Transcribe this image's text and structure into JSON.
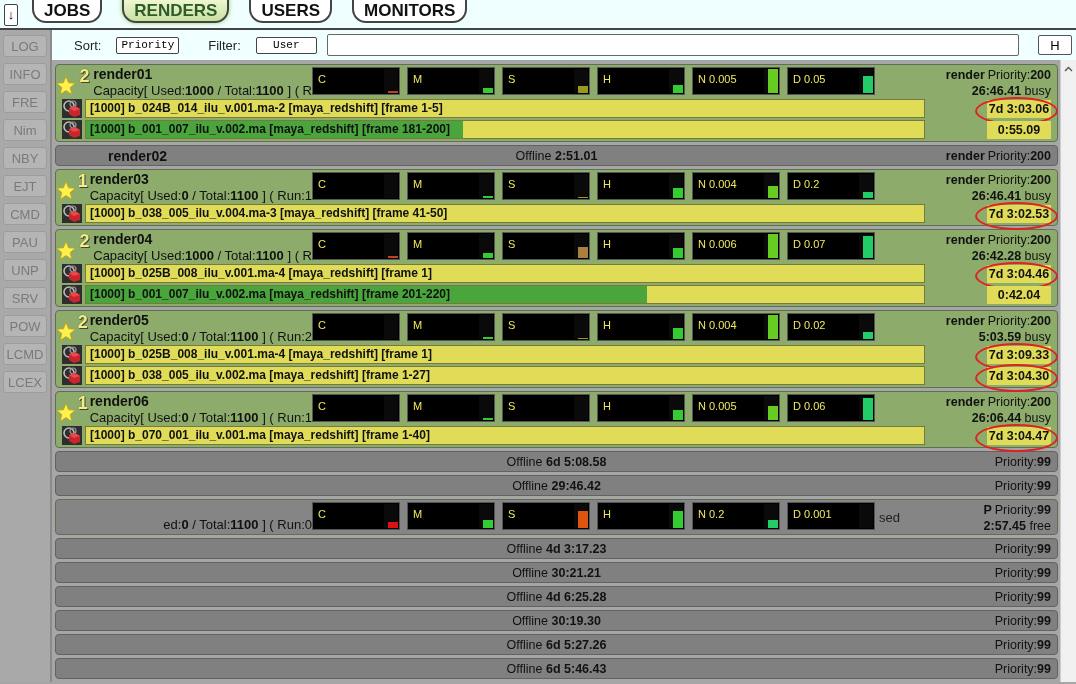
{
  "collapse_button": {
    "label": "↓"
  },
  "tabs": [
    {
      "label": "JOBS",
      "selected": false
    },
    {
      "label": "RENDERS",
      "selected": true
    },
    {
      "label": "USERS",
      "selected": false
    },
    {
      "label": "MONITORS",
      "selected": false
    }
  ],
  "side_buttons": [
    "LOG",
    "INFO",
    "FRE",
    "Nim",
    "NBY",
    "EJT",
    "CMD",
    "PAU",
    "UNP",
    "SRV",
    "POW",
    "LCMD",
    "LCEX"
  ],
  "toolbar": {
    "sort_label": "Sort:",
    "sort_value": "Priority",
    "filter_label": "Filter:",
    "filter_value": "User",
    "h_button": "H"
  },
  "renders": [
    {
      "kind": "online",
      "count": "2",
      "name": "render01",
      "capacity": "Capacity[ Used:**1000** / Total:**1100** ] ( R",
      "meters": [
        {
          "label": "C",
          "level": 0.08,
          "color": "#c04020"
        },
        {
          "label": "M",
          "level": 0.2,
          "color": "#33cc33"
        },
        {
          "label": "S",
          "level": 0.3,
          "color": "#999922"
        },
        {
          "label": "H",
          "level": 0.35,
          "color": "#33cc33"
        },
        {
          "label": "N 0.005",
          "level": 1,
          "color": "#66cc22"
        },
        {
          "label": "D 0.05",
          "level": 0.7,
          "color": "#22cc66"
        }
      ],
      "owner": "render",
      "priority": "Priority:**200**",
      "status": "**26:46.41** busy",
      "tasks": [
        {
          "text": "[1000] b_024B_014_ilu_v.001.ma-2 [maya_redshift] [frame 1-5]",
          "level": 0,
          "time": "7d 3:03.06",
          "circled": true
        },
        {
          "text": "[1000] b_001_007_ilu_v.002.ma [maya_redshift] [frame 181-200]",
          "level": 0.45,
          "time": "0:55.09",
          "circled": false
        }
      ]
    },
    {
      "kind": "offline",
      "name": "render02",
      "status": "Offline **2:51.01**",
      "owner": "render",
      "priority": "Priority:**200**"
    },
    {
      "kind": "online",
      "count": "1",
      "name": "render03",
      "capacity": "Capacity[ Used:**0** / Total:**1100** ] ( Run:1",
      "meters": [
        {
          "label": "C"
        },
        {
          "label": "M",
          "level": 0.08,
          "color": "#33cc33"
        },
        {
          "label": "S",
          "level": 0.06,
          "color": "#999922"
        },
        {
          "label": "H",
          "level": 0.4,
          "color": "#33cc33"
        },
        {
          "label": "N 0.004",
          "level": 0.5,
          "color": "#66cc22"
        },
        {
          "label": "D 0.2",
          "level": 0.25,
          "color": "#22cc66"
        }
      ],
      "owner": "render",
      "priority": "Priority:**200**",
      "status": "**26:46.41** busy",
      "tasks": [
        {
          "text": "[1000] b_038_005_ilu_v.004.ma-3 [maya_redshift] [frame 41-50]",
          "level": 0,
          "time": "7d 3:02.53",
          "circled": true
        }
      ]
    },
    {
      "kind": "online",
      "count": "2",
      "name": "render04",
      "capacity": "Capacity[ Used:**1000** / Total:**1100** ] ( R",
      "meters": [
        {
          "label": "C",
          "level": 0.1,
          "color": "#c04020"
        },
        {
          "label": "M",
          "level": 0.2,
          "color": "#33cc33"
        },
        {
          "label": "S",
          "level": 0.45,
          "color": "#aa8040"
        },
        {
          "label": "H",
          "level": 0.4,
          "color": "#33cc33"
        },
        {
          "label": "N 0.006",
          "level": 1,
          "color": "#66cc22"
        },
        {
          "label": "D 0.07",
          "level": 0.9,
          "color": "#22cc66"
        }
      ],
      "owner": "render",
      "priority": "Priority:**200**",
      "status": "**26:42.28** busy",
      "tasks": [
        {
          "text": "[1000] b_025B_008_ilu_v.001.ma-4 [maya_redshift] [frame 1]",
          "level": 0,
          "time": "7d 3:04.46",
          "circled": true
        },
        {
          "text": "[1000] b_001_007_ilu_v.002.ma [maya_redshift] [frame 201-220]",
          "level": 0.67,
          "time": "0:42.04",
          "circled": false
        }
      ]
    },
    {
      "kind": "online",
      "count": "2",
      "name": "render05",
      "capacity": "Capacity[ Used:**0** / Total:**1100** ] ( Run:2",
      "meters": [
        {
          "label": "C"
        },
        {
          "label": "M",
          "level": 0.08,
          "color": "#33cc33"
        },
        {
          "label": "S",
          "level": 0.06,
          "color": "#999922"
        },
        {
          "label": "H",
          "level": 0.45,
          "color": "#33cc33"
        },
        {
          "label": "N 0.004",
          "level": 1,
          "color": "#66cc22"
        },
        {
          "label": "D 0.02",
          "level": 0.3,
          "color": "#22cc66"
        }
      ],
      "owner": "render",
      "priority": "Priority:**200**",
      "status": "**5:03.59** busy",
      "tasks": [
        {
          "text": "[1000] b_025B_008_ilu_v.001.ma-4 [maya_redshift] [frame 1]",
          "level": 0,
          "time": "7d 3:09.33",
          "circled": true
        },
        {
          "text": "[1000] b_038_005_ilu_v.002.ma [maya_redshift] [frame 1-27]",
          "level": 0,
          "time": "7d 3:04.30",
          "circled": true
        }
      ]
    },
    {
      "kind": "online",
      "count": "1",
      "name": "render06",
      "capacity": "Capacity[ Used:**0** / Total:**1100** ] ( Run:1",
      "meters": [
        {
          "label": "C"
        },
        {
          "label": "M",
          "level": 0.08,
          "color": "#33cc33"
        },
        {
          "label": "S"
        },
        {
          "label": "H",
          "level": 0.4,
          "color": "#33cc33"
        },
        {
          "label": "N 0.005",
          "level": 0.6,
          "color": "#66cc22"
        },
        {
          "label": "D 0.06",
          "level": 0.9,
          "color": "#22cc66"
        }
      ],
      "owner": "render",
      "priority": "Priority:**200**",
      "status": "**26:06.44** busy",
      "tasks": [
        {
          "text": "[1000] b_070_001_ilu_v.001.ma [maya_redshift] [frame 1-40]",
          "level": 0,
          "time": "7d 3:04.47",
          "circled": true
        }
      ]
    },
    {
      "kind": "offline",
      "status": "Offline **6d 5:08.58**",
      "priority": "Priority:**99**"
    },
    {
      "kind": "offline",
      "status": "Offline **29:46.42**",
      "priority": "Priority:**99**"
    },
    {
      "kind": "free",
      "capacity": "ed:**0** / Total:**1100** ] ( Run:0",
      "meters": [
        {
          "label": "C",
          "level": 0.25,
          "color": "#dd1111"
        },
        {
          "label": "M",
          "level": 0.35,
          "color": "#33cc33"
        },
        {
          "label": "S",
          "level": 0.7,
          "color": "#dd5511"
        },
        {
          "label": "H",
          "level": 0.7,
          "color": "#33cc33"
        },
        {
          "label": "N 0.2",
          "level": 0.35,
          "color": "#22cc66"
        },
        {
          "label": "D 0.001"
        }
      ],
      "note": "sed",
      "owner": "P",
      "priority": "Priority:**99**",
      "status": "**2:57.45** free"
    },
    {
      "kind": "offline",
      "status": "Offline **4d 3:17.23**",
      "priority": "Priority:**99**"
    },
    {
      "kind": "offline",
      "status": "Offline **30:21.21**",
      "priority": "Priority:**99**"
    },
    {
      "kind": "offline",
      "status": "Offline **4d 6:25.28**",
      "priority": "Priority:**99**"
    },
    {
      "kind": "offline",
      "status": "Offline **30:19.30**",
      "priority": "Priority:**99**"
    },
    {
      "kind": "offline",
      "status": "Offline **6d 5:27.26**",
      "priority": "Priority:**99**"
    },
    {
      "kind": "offline",
      "status": "Offline **6d 5:46.43**",
      "priority": "Priority:**99**"
    }
  ]
}
